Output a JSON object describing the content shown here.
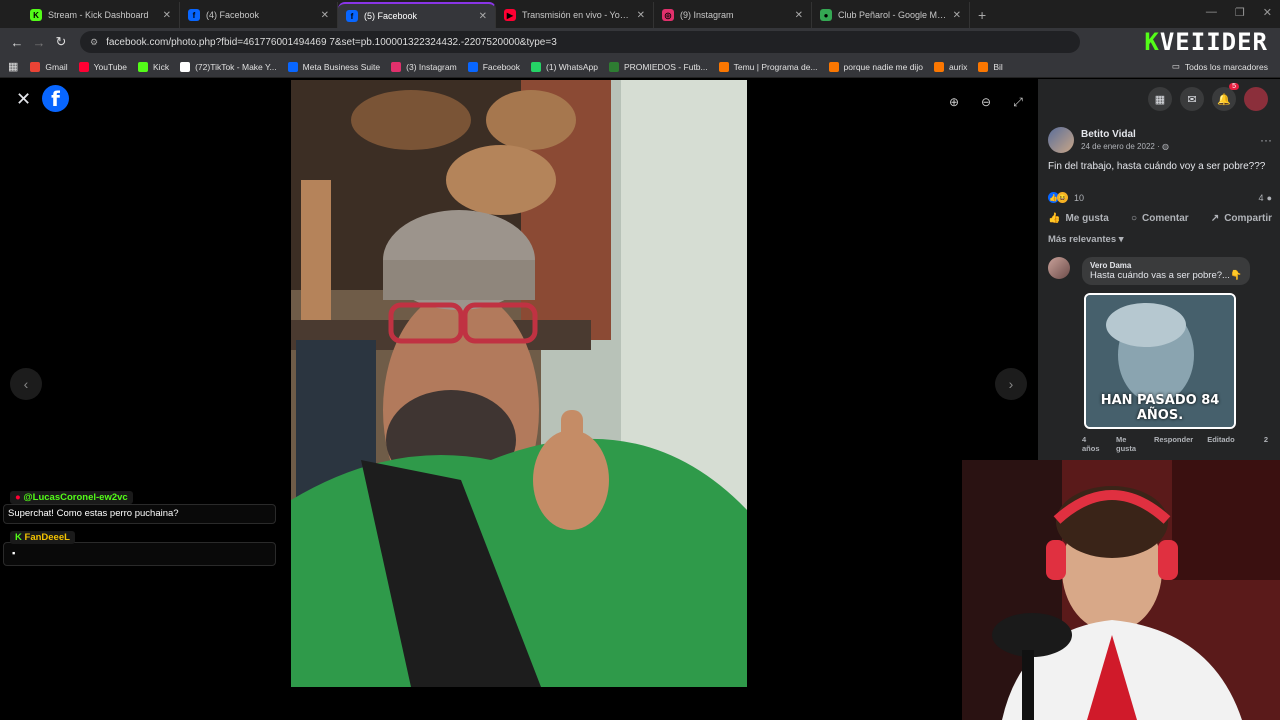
{
  "tabs": [
    {
      "title": "Stream - Kick Dashboard",
      "fav": "K",
      "color": "#53fc18",
      "active": false
    },
    {
      "title": "(4) Facebook",
      "fav": "f",
      "color": "#0866ff",
      "active": false
    },
    {
      "title": "(5) Facebook",
      "fav": "f",
      "color": "#0866ff",
      "active": true
    },
    {
      "title": "Transmisión en vivo - YouTube",
      "fav": "▶",
      "color": "#ff0033",
      "active": false
    },
    {
      "title": "(9) Instagram",
      "fav": "◎",
      "color": "#e1306c",
      "active": false
    },
    {
      "title": "Club Peñarol - Google Maps",
      "fav": "●",
      "color": "#34a853",
      "active": false
    }
  ],
  "address": {
    "url": "facebook.com/photo.php?fbid=461776001494469 7&set=pb.100001322324432.-2207520000&type=3"
  },
  "brand": {
    "k": "K",
    "rest": "VEIIDER"
  },
  "bookmarks": [
    {
      "label": "Gmail",
      "color": "#ea4335"
    },
    {
      "label": "YouTube",
      "color": "#ff0033"
    },
    {
      "label": "Kick",
      "color": "#53fc18"
    },
    {
      "label": "(72)TikTok - Make Y...",
      "color": "#ffffff"
    },
    {
      "label": "Meta Business Suite",
      "color": "#0866ff"
    },
    {
      "label": "(3) Instagram",
      "color": "#e1306c"
    },
    {
      "label": "Facebook",
      "color": "#0866ff"
    },
    {
      "label": "(1) WhatsApp",
      "color": "#25d366"
    },
    {
      "label": "PROMIEDOS - Futb...",
      "color": "#2e7d32"
    },
    {
      "label": "Temu | Programa de...",
      "color": "#fb7701"
    },
    {
      "label": "porque nadie me dijo",
      "color": "#fb7701"
    },
    {
      "label": "aurix",
      "color": "#fb7701"
    },
    {
      "label": "Bil",
      "color": "#fb7701"
    }
  ],
  "bookmarks_folder": "Todos los marcadores",
  "post": {
    "author": "Betito Vidal",
    "date": "24 de enero de 2022 · ◍",
    "text": "Fin del trabajo, hasta cuándo voy a ser pobre???",
    "reactions_count": "10",
    "comments_count": "4",
    "like": "Me gusta",
    "comment": "Comentar",
    "share": "Compartir",
    "sort": "Más relevantes"
  },
  "comment": {
    "author": "Vero Dama",
    "text": "Hasta cuándo vas a ser pobre?...👇",
    "image_caption": "HAN PASADO 84 AÑOS.",
    "age": "4 años",
    "like": "Me gusta",
    "reply": "Responder",
    "edited": "Editado",
    "reactions": "2"
  },
  "chat": [
    {
      "user": "@LucasCoronel-ew2vc",
      "text": "Superchat! Como estas perro puchaina?",
      "color": "#53fc18"
    },
    {
      "user": "FanDeeeL",
      "text": "",
      "color": "#f2c200"
    }
  ],
  "notifications": "5"
}
